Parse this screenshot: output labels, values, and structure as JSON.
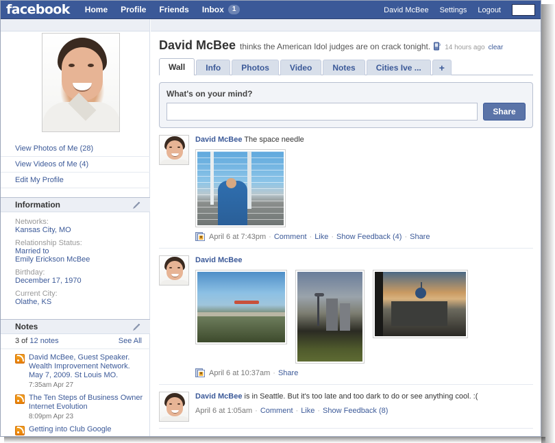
{
  "topbar": {
    "logo": "facebook",
    "nav": [
      {
        "label": "Home",
        "name": "home"
      },
      {
        "label": "Profile",
        "name": "profile"
      },
      {
        "label": "Friends",
        "name": "friends"
      }
    ],
    "inbox_label": "Inbox",
    "inbox_count": "1",
    "account_name": "David McBee",
    "settings_label": "Settings",
    "logout_label": "Logout",
    "search_value": "",
    "brand_color": "#3b5998"
  },
  "sidebar": {
    "links": [
      {
        "label": "View Photos of Me (28)",
        "name": "view-photos-of-me"
      },
      {
        "label": "View Videos of Me (4)",
        "name": "view-videos-of-me"
      },
      {
        "label": "Edit My Profile",
        "name": "edit-my-profile"
      }
    ],
    "information": {
      "title": "Information",
      "fields": [
        {
          "label": "Networks:",
          "values": [
            "Kansas City, MO"
          ]
        },
        {
          "label": "Relationship Status:",
          "values": [
            "Married to",
            "Emily Erickson McBee"
          ]
        },
        {
          "label": "Birthday:",
          "values": [
            "December 17, 1970"
          ]
        },
        {
          "label": "Current City:",
          "values": [
            "Olathe, KS"
          ]
        }
      ]
    },
    "notes": {
      "title": "Notes",
      "count_prefix": "3 of ",
      "count_link": "12 notes",
      "see_all": "See All",
      "items": [
        {
          "title": "David McBee, Guest Speaker. Wealth Improvement Network. May 7, 2009. St Louis MO.",
          "time": "7:35am Apr 27"
        },
        {
          "title": "The Ten Steps of Business Owner Internet Evolution",
          "time": "8:09pm Apr 23"
        },
        {
          "title": "Getting into Club Google",
          "time": ""
        }
      ]
    }
  },
  "main": {
    "status": {
      "name": "David McBee",
      "text": "thinks the American Idol judges are on crack tonight.",
      "time": "14 hours ago",
      "clear_label": "clear"
    },
    "tabs": [
      {
        "label": "Wall",
        "active": true
      },
      {
        "label": "Info",
        "active": false
      },
      {
        "label": "Photos",
        "active": false
      },
      {
        "label": "Video",
        "active": false
      },
      {
        "label": "Notes",
        "active": false
      },
      {
        "label": "Cities Ive ...",
        "active": false
      },
      {
        "label": "+",
        "active": false
      }
    ],
    "composer": {
      "label": "What's on your mind?",
      "value": "",
      "placeholder": "",
      "share_label": "Share"
    },
    "posts": [
      {
        "author": "David McBee",
        "message": " The space needle",
        "time": "April 6 at 7:43pm",
        "actions": [
          "Comment",
          "Like",
          "Show Feedback (4)",
          "Share"
        ]
      },
      {
        "author": "David McBee",
        "message": "",
        "time": "April 6 at 10:37am",
        "actions": [
          "Share"
        ]
      },
      {
        "author": "David McBee",
        "message": " is in Seattle. But it's too late and too dark to do or see anything cool. :(",
        "time": "April 6 at 1:05am",
        "actions": [
          "Comment",
          "Like",
          "Show Feedback (8)"
        ]
      }
    ]
  }
}
